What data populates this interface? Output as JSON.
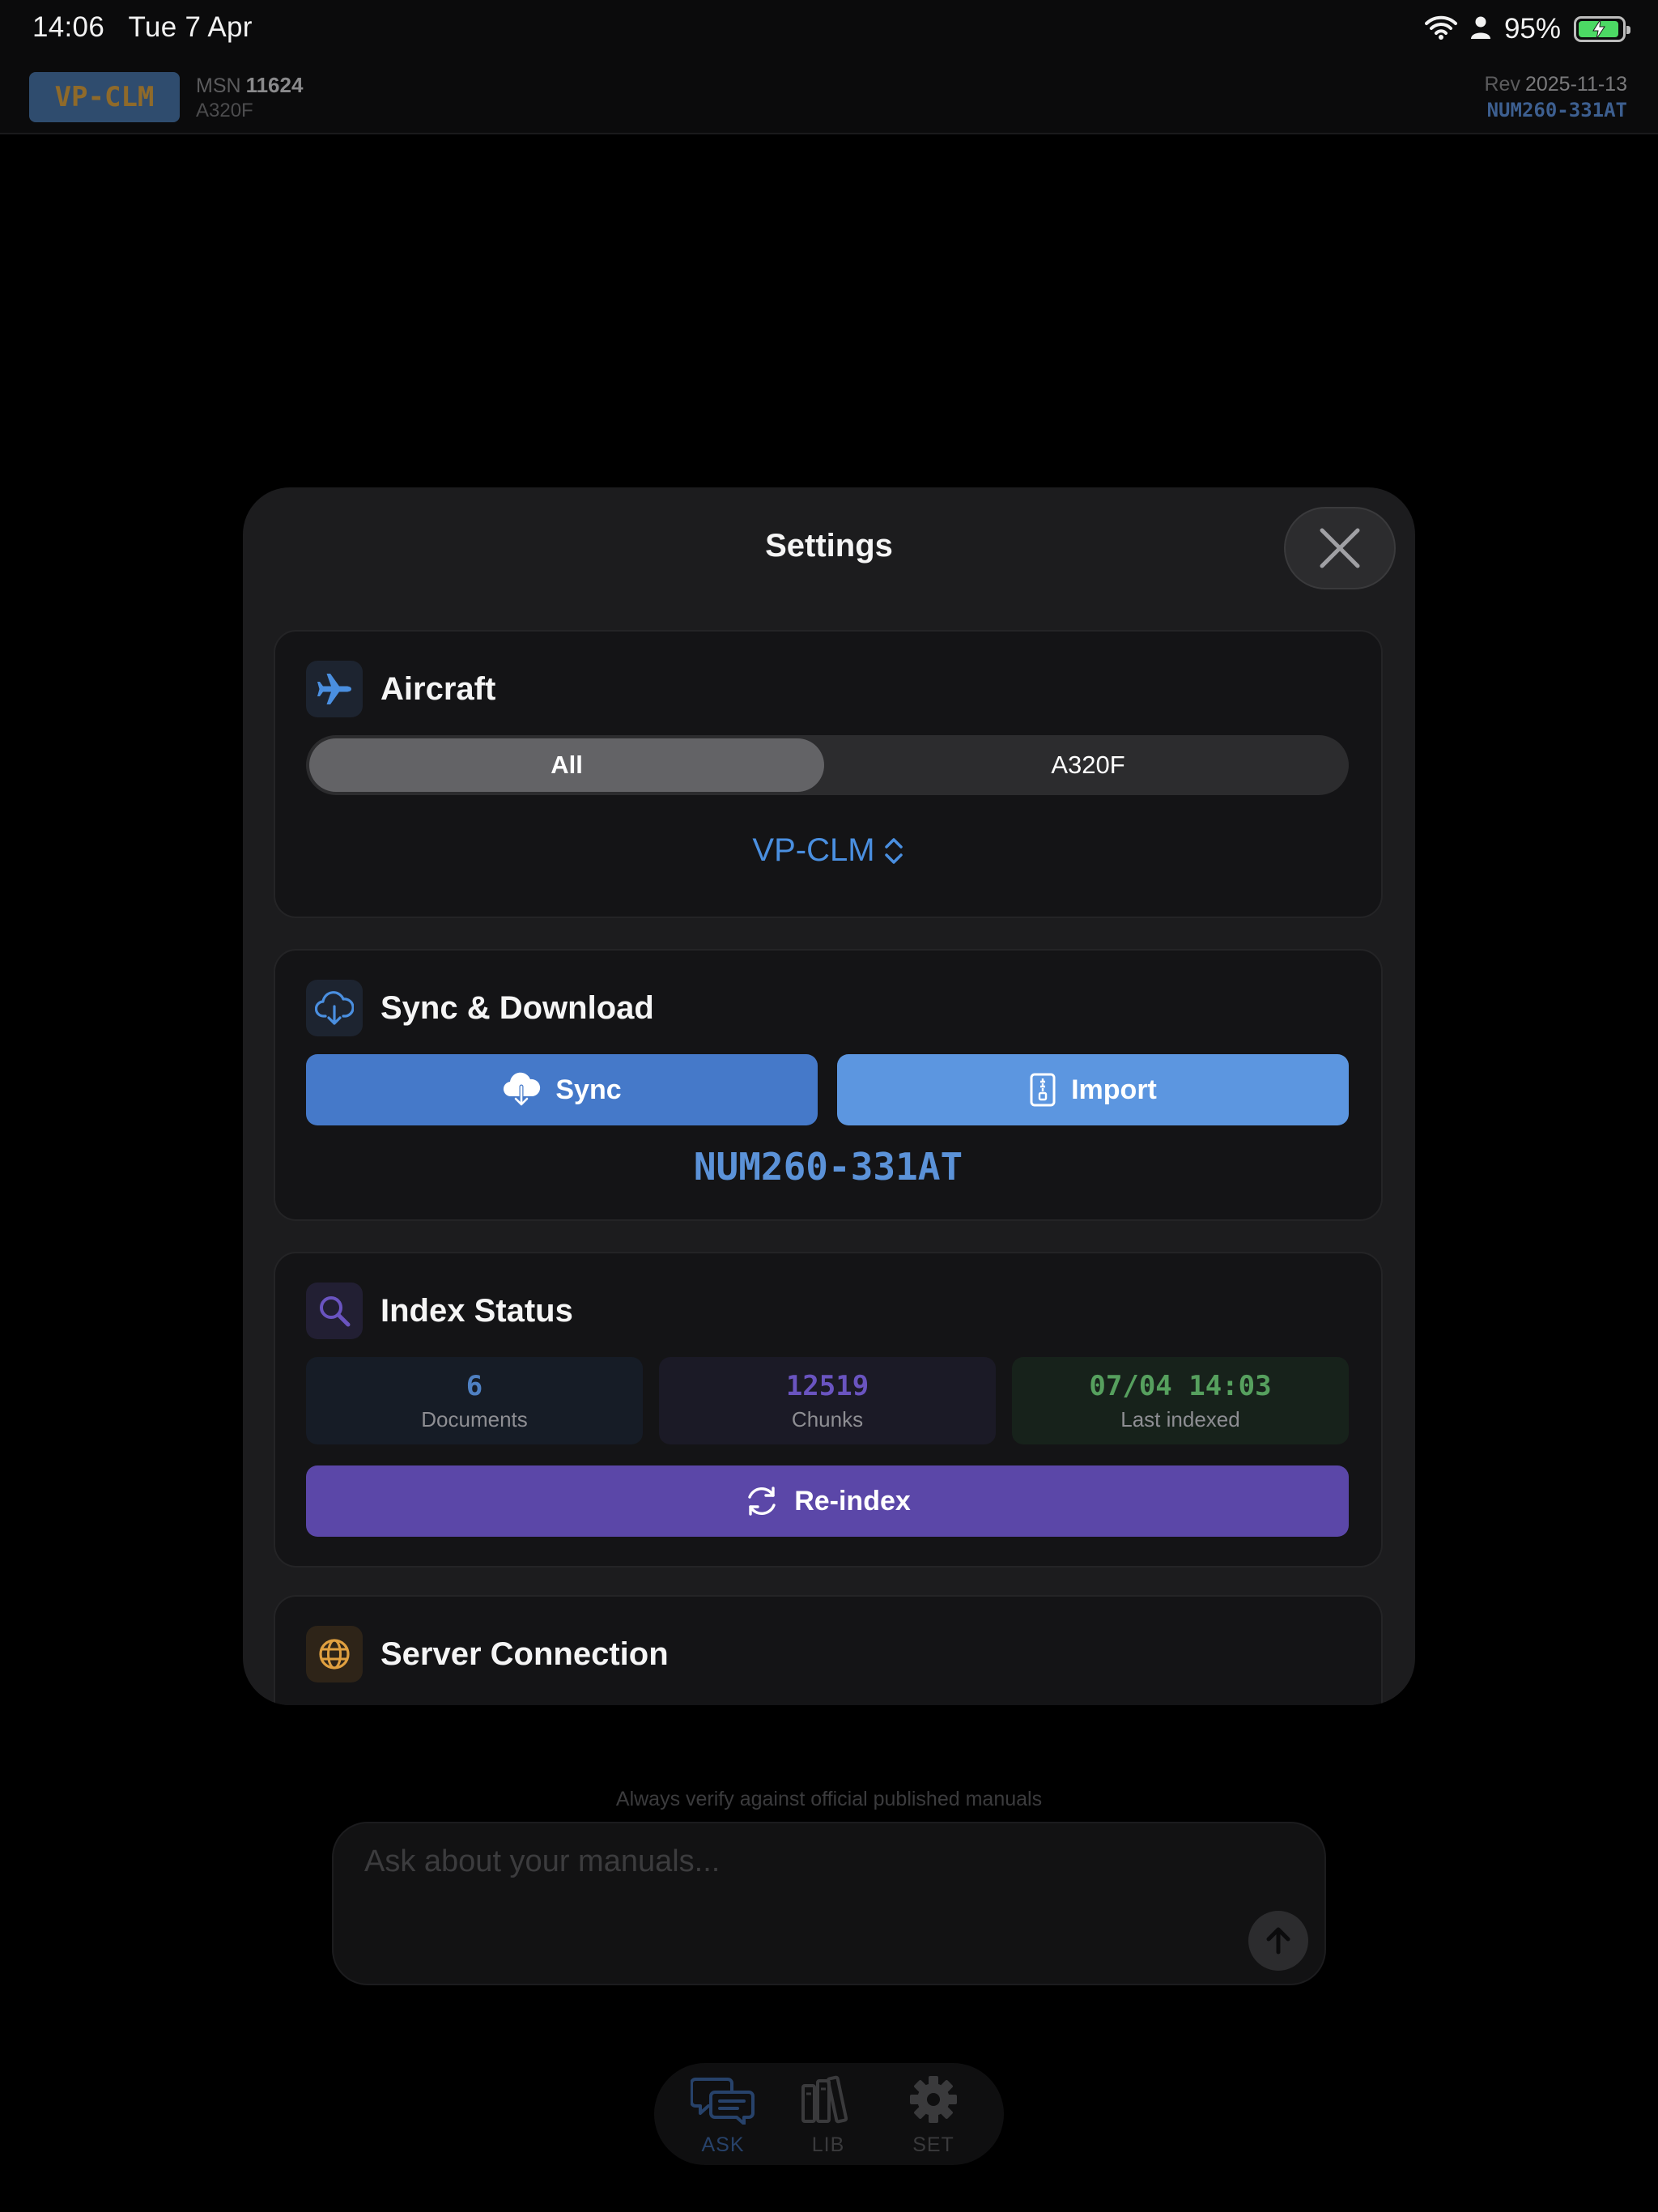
{
  "status_bar": {
    "time": "14:06",
    "date": "Tue 7 Apr",
    "battery_percent": "95%",
    "battery_level": 0.95
  },
  "header": {
    "registration": "VP-CLM",
    "msn_label": "MSN",
    "msn": "11624",
    "aircraft_type": "A320F",
    "rev_label": "Rev",
    "revision": "2025-11-13",
    "document": "NUM260-331AT"
  },
  "settings": {
    "title": "Settings",
    "aircraft": {
      "title": "Aircraft",
      "segments": [
        "All",
        "A320F"
      ],
      "selected_segment": "All",
      "registration_picker": "VP-CLM"
    },
    "sync": {
      "title": "Sync & Download",
      "sync_label": "Sync",
      "import_label": "Import",
      "document_code": "NUM260-331AT"
    },
    "index_status": {
      "title": "Index Status",
      "documents_value": "6",
      "documents_label": "Documents",
      "chunks_value": "12519",
      "chunks_label": "Chunks",
      "last_indexed_value": "07/04 14:03",
      "last_indexed_label": "Last indexed",
      "reindex_label": "Re-index"
    },
    "server": {
      "title": "Server Connection"
    }
  },
  "composer": {
    "footnote": "Always verify against official published manuals",
    "placeholder": "Ask about your manuals..."
  },
  "tab_bar": {
    "ask": "ASK",
    "lib": "LIB",
    "set": "SET"
  },
  "colors": {
    "accent_blue": "#4a8fe0",
    "sync_blue": "#4579c9",
    "import_blue": "#5c96e0",
    "reindex_purple": "#5b47a8",
    "last_indexed_green": "#56a05e",
    "server_icon_orange": "#e0a040"
  },
  "icons": {
    "aircraft": "airplane-icon",
    "sync_card": "cloud-download-icon",
    "sync_button": "cloud-download-icon",
    "import_button": "document-zip-icon",
    "index": "magnifier-icon",
    "reindex": "refresh-icon",
    "server": "globe-icon",
    "close": "close-icon",
    "send": "arrow-up-icon",
    "tab_ask": "chat-bubbles-icon",
    "tab_lib": "books-icon",
    "tab_set": "gear-icon"
  }
}
